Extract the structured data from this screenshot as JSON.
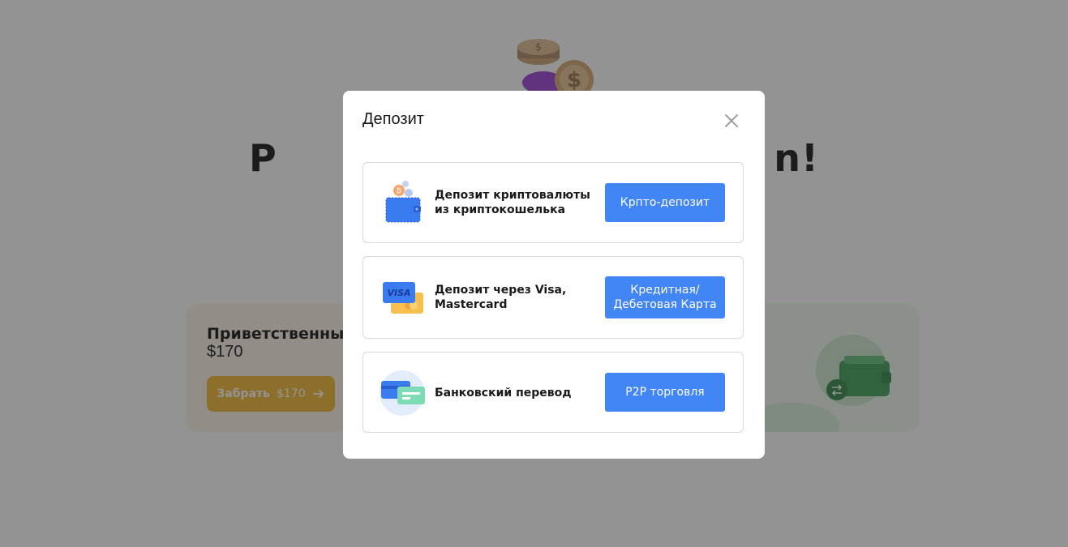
{
  "background": {
    "hero_title": "P                                    n!",
    "bonus": {
      "title": "Приветственный бонус до",
      "amount": "$170",
      "button_label": "Забрать",
      "button_amount": "$170"
    }
  },
  "modal": {
    "title": "Депозит",
    "options": [
      {
        "label": "Депозит криптовалюты из криптокошелька",
        "button": "Крпто-депозит",
        "icon": "crypto-wallet-icon"
      },
      {
        "label": "Депозит через Visa, Mastercard",
        "button": "Кредитная/ Дебетовая Карта",
        "icon": "visa-card-icon",
        "icon_text": "VISA"
      },
      {
        "label": "Банковский перевод",
        "button": "P2P торговля",
        "icon": "bank-cards-icon"
      }
    ]
  },
  "colors": {
    "primary_button": "#4285f4",
    "bonus_button": "#f2b730",
    "overlay": "rgba(40,40,40,0.5)"
  }
}
